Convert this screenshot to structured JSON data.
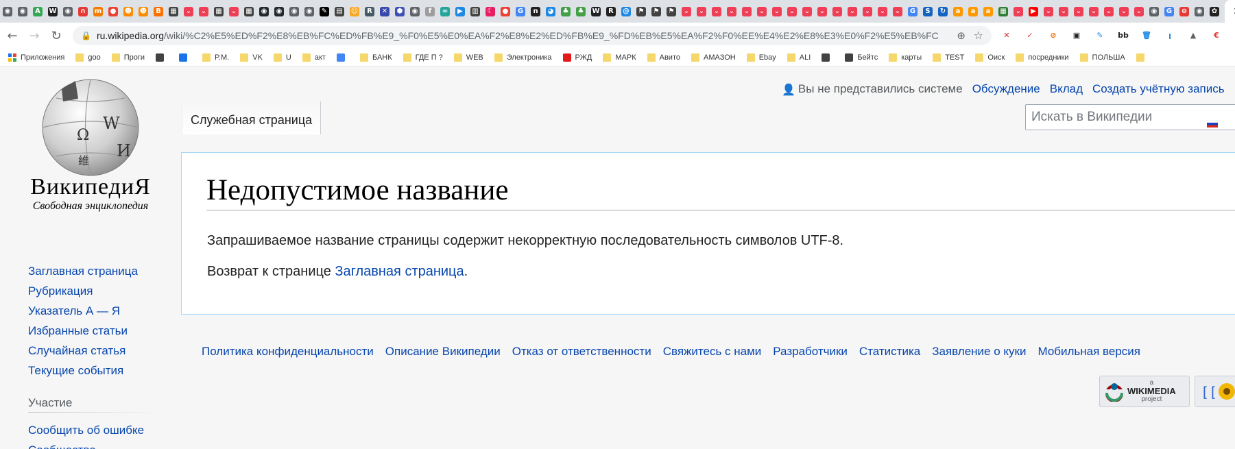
{
  "browser": {
    "tab_favicons": [
      {
        "icon": "globe-icon",
        "color": "#5f6368",
        "glyph": "◉"
      },
      {
        "icon": "globe-icon",
        "color": "#5f6368",
        "glyph": "◉"
      },
      {
        "icon": "a-letter-icon",
        "color": "#34a853",
        "glyph": "A"
      },
      {
        "icon": "wikipedia-icon",
        "color": "#202124",
        "glyph": "W"
      },
      {
        "icon": "globe-icon",
        "color": "#5f6368",
        "glyph": "◉"
      },
      {
        "icon": "horseshoe-icon",
        "color": "#e53935",
        "glyph": "∩"
      },
      {
        "icon": "mkt-icon",
        "color": "#f57c00",
        "glyph": "m"
      },
      {
        "icon": "map-pin-icon",
        "color": "#ea4335",
        "glyph": "●"
      },
      {
        "icon": "character-icon",
        "color": "#fb8c00",
        "glyph": "☻"
      },
      {
        "icon": "character-icon",
        "color": "#fb8c00",
        "glyph": "☻"
      },
      {
        "icon": "blogger-icon",
        "color": "#ff6f00",
        "glyph": "B"
      },
      {
        "icon": "keyboard-icon",
        "color": "#424242",
        "glyph": "▦"
      },
      {
        "icon": "pocket-icon",
        "color": "#ef3f56",
        "glyph": "⌄"
      },
      {
        "icon": "pocket-icon",
        "color": "#ef3f56",
        "glyph": "⌄"
      },
      {
        "icon": "keyboard-icon",
        "color": "#424242",
        "glyph": "▦"
      },
      {
        "icon": "pocket-icon",
        "color": "#ef3f56",
        "glyph": "⌄"
      },
      {
        "icon": "keyboard-icon",
        "color": "#424242",
        "glyph": "▦"
      },
      {
        "icon": "github-icon",
        "color": "#24292e",
        "glyph": "◉"
      },
      {
        "icon": "github-icon",
        "color": "#24292e",
        "glyph": "◉"
      },
      {
        "icon": "globe-icon",
        "color": "#5f6368",
        "glyph": "◉"
      },
      {
        "icon": "globe-icon",
        "color": "#5f6368",
        "glyph": "◉"
      },
      {
        "icon": "pen-icon",
        "color": "#000000",
        "glyph": "✎"
      },
      {
        "icon": "book-icon",
        "color": "#424242",
        "glyph": "▤"
      },
      {
        "icon": "smiley-icon",
        "color": "#f9a825",
        "glyph": "☺"
      },
      {
        "icon": "r-box-icon",
        "color": "#455a64",
        "glyph": "R"
      },
      {
        "icon": "x-logo-icon",
        "color": "#3949ab",
        "glyph": "✕"
      },
      {
        "icon": "hexagon-icon",
        "color": "#3f51b5",
        "glyph": "⬢"
      },
      {
        "icon": "globe-icon",
        "color": "#5f6368",
        "glyph": "◉"
      },
      {
        "icon": "f-letter-icon",
        "color": "#9e9e9e",
        "glyph": "f"
      },
      {
        "icon": "network-icon",
        "color": "#26a69a",
        "glyph": "∞"
      },
      {
        "icon": "bird-icon",
        "color": "#1e88e5",
        "glyph": "▶"
      },
      {
        "icon": "book-open-icon",
        "color": "#424242",
        "glyph": "▥"
      },
      {
        "icon": "moon-icon",
        "color": "#e91e63",
        "glyph": "☾"
      },
      {
        "icon": "map-pin-icon",
        "color": "#ea4335",
        "glyph": "●"
      },
      {
        "icon": "google-icon",
        "color": "#4285f4",
        "glyph": "G"
      },
      {
        "icon": "n-box-icon",
        "color": "#212121",
        "glyph": "n"
      },
      {
        "icon": "circle-icon",
        "color": "#1e88e5",
        "glyph": "◕"
      },
      {
        "icon": "tree-icon",
        "color": "#43a047",
        "glyph": "♣"
      },
      {
        "icon": "tree-icon",
        "color": "#43a047",
        "glyph": "♣"
      },
      {
        "icon": "wikipedia-icon",
        "color": "#202124",
        "glyph": "W"
      },
      {
        "icon": "r-letter-icon",
        "color": "#212121",
        "glyph": "R"
      },
      {
        "icon": "at-sign-icon",
        "color": "#1e88e5",
        "glyph": "@"
      },
      {
        "icon": "flag-icon",
        "color": "#424242",
        "glyph": "⚑"
      },
      {
        "icon": "flag-icon",
        "color": "#424242",
        "glyph": "⚑"
      },
      {
        "icon": "flag-icon",
        "color": "#424242",
        "glyph": "⚑"
      },
      {
        "icon": "pocket-icon",
        "color": "#ef3f56",
        "glyph": "⌄"
      },
      {
        "icon": "pocket-icon",
        "color": "#ef3f56",
        "glyph": "⌄"
      },
      {
        "icon": "pocket-icon",
        "color": "#ef3f56",
        "glyph": "⌄"
      },
      {
        "icon": "pocket-icon",
        "color": "#ef3f56",
        "glyph": "⌄"
      },
      {
        "icon": "pocket-icon",
        "color": "#ef3f56",
        "glyph": "⌄"
      },
      {
        "icon": "pocket-icon",
        "color": "#ef3f56",
        "glyph": "⌄"
      },
      {
        "icon": "pocket-icon",
        "color": "#ef3f56",
        "glyph": "⌄"
      },
      {
        "icon": "pocket-icon",
        "color": "#ef3f56",
        "glyph": "⌄"
      },
      {
        "icon": "pocket-icon",
        "color": "#ef3f56",
        "glyph": "⌄"
      },
      {
        "icon": "pocket-icon",
        "color": "#ef3f56",
        "glyph": "⌄"
      },
      {
        "icon": "pocket-icon",
        "color": "#ef3f56",
        "glyph": "⌄"
      },
      {
        "icon": "pocket-icon",
        "color": "#ef3f56",
        "glyph": "⌄"
      },
      {
        "icon": "pocket-icon",
        "color": "#ef3f56",
        "glyph": "⌄"
      },
      {
        "icon": "pocket-icon",
        "color": "#ef3f56",
        "glyph": "⌄"
      },
      {
        "icon": "pocket-icon",
        "color": "#ef3f56",
        "glyph": "⌄"
      },
      {
        "icon": "google-icon",
        "color": "#4285f4",
        "glyph": "G"
      },
      {
        "icon": "s-letter-icon",
        "color": "#1565c0",
        "glyph": "S"
      },
      {
        "icon": "arrow-box-icon",
        "color": "#1565c0",
        "glyph": "↻"
      },
      {
        "icon": "amazon-icon",
        "color": "#ff9900",
        "glyph": "a"
      },
      {
        "icon": "amazon-icon",
        "color": "#ff9900",
        "glyph": "a"
      },
      {
        "icon": "amazon-icon",
        "color": "#ff9900",
        "glyph": "a"
      },
      {
        "icon": "grid-pattern-icon",
        "color": "#2e7d32",
        "glyph": "▦"
      },
      {
        "icon": "pocket-icon",
        "color": "#ef3f56",
        "glyph": "⌄"
      },
      {
        "icon": "youtube-icon",
        "color": "#ff0000",
        "glyph": "▶"
      },
      {
        "icon": "pocket-icon",
        "color": "#ef3f56",
        "glyph": "⌄"
      },
      {
        "icon": "pocket-icon",
        "color": "#ef3f56",
        "glyph": "⌄"
      },
      {
        "icon": "pocket-icon",
        "color": "#ef3f56",
        "glyph": "⌄"
      },
      {
        "icon": "pocket-icon",
        "color": "#ef3f56",
        "glyph": "⌄"
      },
      {
        "icon": "pocket-icon",
        "color": "#ef3f56",
        "glyph": "⌄"
      },
      {
        "icon": "pocket-icon",
        "color": "#ef3f56",
        "glyph": "⌄"
      },
      {
        "icon": "pocket-icon",
        "color": "#ef3f56",
        "glyph": "⌄"
      },
      {
        "icon": "globe-icon",
        "color": "#5f6368",
        "glyph": "◉"
      },
      {
        "icon": "google-icon",
        "color": "#4285f4",
        "glyph": "G"
      },
      {
        "icon": "stop-icon",
        "color": "#e53935",
        "glyph": "⊖"
      },
      {
        "icon": "globe-icon",
        "color": "#5f6368",
        "glyph": "◉"
      },
      {
        "icon": "settings-wheel-icon",
        "color": "#212121",
        "glyph": "✿"
      }
    ],
    "address_bar": {
      "host": "ru.wikipedia.org",
      "path": "/wiki/%C2%E5%ED%F2%E8%EB%FC%ED%FB%E9_%F0%E5%E0%EA%F2%E8%E2%ED%FB%E9_%FD%EB%E5%EA%F2%F0%EE%E4%E2%E8%E3%E0%F2%E5%EB%FC"
    },
    "extensions": [
      {
        "icon": "x-red-icon",
        "color": "#c62828",
        "glyph": "✕"
      },
      {
        "icon": "feather-icon",
        "color": "#e53935",
        "glyph": "✓"
      },
      {
        "icon": "block-icon",
        "color": "#ef6c00",
        "glyph": "⊘"
      },
      {
        "icon": "badge-icon",
        "color": "#212121",
        "glyph": "▣"
      },
      {
        "icon": "note-icon",
        "color": "#1e88e5",
        "glyph": "✎"
      },
      {
        "icon": "bb-icon",
        "color": "#212121",
        "glyph": "bb"
      },
      {
        "icon": "trash-icon",
        "color": "#1e88e5",
        "glyph": "🗑"
      },
      {
        "icon": "text-cursor-icon",
        "color": "#1e88e5",
        "glyph": "ꞁ"
      },
      {
        "icon": "drive-icon",
        "color": "#5f6368",
        "glyph": "▲"
      },
      {
        "icon": "euro-icon",
        "color": "#e53935",
        "glyph": "€"
      },
      {
        "icon": "more-icon",
        "color": "#5f6368",
        "glyph": "⋮"
      }
    ],
    "bookmarks": [
      {
        "label": "Приложения",
        "icon": "apps-grid-icon"
      },
      {
        "label": "goo",
        "icon": "folder-icon"
      },
      {
        "label": "Проги",
        "icon": "folder-icon"
      },
      {
        "label": "",
        "icon": "tag-icon"
      },
      {
        "label": "",
        "icon": "mail-icon"
      },
      {
        "label": "P.M.",
        "icon": "folder-icon"
      },
      {
        "label": "VK",
        "icon": "folder-icon"
      },
      {
        "label": "U",
        "icon": "folder-icon"
      },
      {
        "label": "акт",
        "icon": "folder-icon"
      },
      {
        "label": "",
        "icon": "translate-icon"
      },
      {
        "label": "БАНК",
        "icon": "folder-icon"
      },
      {
        "label": "ГДЕ П ?",
        "icon": "folder-icon"
      },
      {
        "label": "WEB",
        "icon": "folder-icon"
      },
      {
        "label": "Электроника",
        "icon": "folder-icon"
      },
      {
        "label": "РЖД",
        "icon": "rzd-icon"
      },
      {
        "label": "МАРК",
        "icon": "folder-icon"
      },
      {
        "label": "Авито",
        "icon": "folder-icon"
      },
      {
        "label": "АМАЗОН",
        "icon": "folder-icon"
      },
      {
        "label": "Ebay",
        "icon": "folder-icon"
      },
      {
        "label": "ALI",
        "icon": "folder-icon"
      },
      {
        "label": "",
        "icon": "bow-icon"
      },
      {
        "label": "Бейтс",
        "icon": "chart-icon"
      },
      {
        "label": "карты",
        "icon": "folder-icon"
      },
      {
        "label": "TEST",
        "icon": "folder-icon"
      },
      {
        "label": "Оиск",
        "icon": "folder-icon"
      },
      {
        "label": "посредники",
        "icon": "folder-icon"
      },
      {
        "label": "ПОЛЬША",
        "icon": "folder-icon"
      },
      {
        "label": "",
        "icon": "folder-icon"
      }
    ]
  },
  "wiki": {
    "wordmark": "ВикипедиЯ",
    "tagline": "Свободная энциклопедия",
    "personal": {
      "anon_label": "Вы не представились системе",
      "talk": "Обсуждение",
      "contributions": "Вклад",
      "create_account": "Создать учётную запись"
    },
    "tab_label": "Служебная страница",
    "search_placeholder": "Искать в Википедии",
    "heading": "Недопустимое название",
    "message": "Запрашиваемое название страницы содержит некорректную последовательность символов UTF-8.",
    "return_prefix": "Возврат к странице ",
    "return_link": "Заглавная страница",
    "return_suffix": ".",
    "navigation": [
      "Заглавная страница",
      "Рубрикация",
      "Указатель А — Я",
      "Избранные статьи",
      "Случайная статья",
      "Текущие события"
    ],
    "participation_heading": "Участие",
    "participation": [
      "Сообщить об ошибке",
      "Сообщество"
    ],
    "footer": [
      "Политика конфиденциальности",
      "Описание Википедии",
      "Отказ от ответственности",
      "Свяжитесь с нами",
      "Разработчики",
      "Статистика",
      "Заявление о куки",
      "Мобильная версия"
    ],
    "wikimedia_badge": {
      "title": "WIKIMEDIA",
      "sub": "project",
      "pre": "a"
    }
  }
}
